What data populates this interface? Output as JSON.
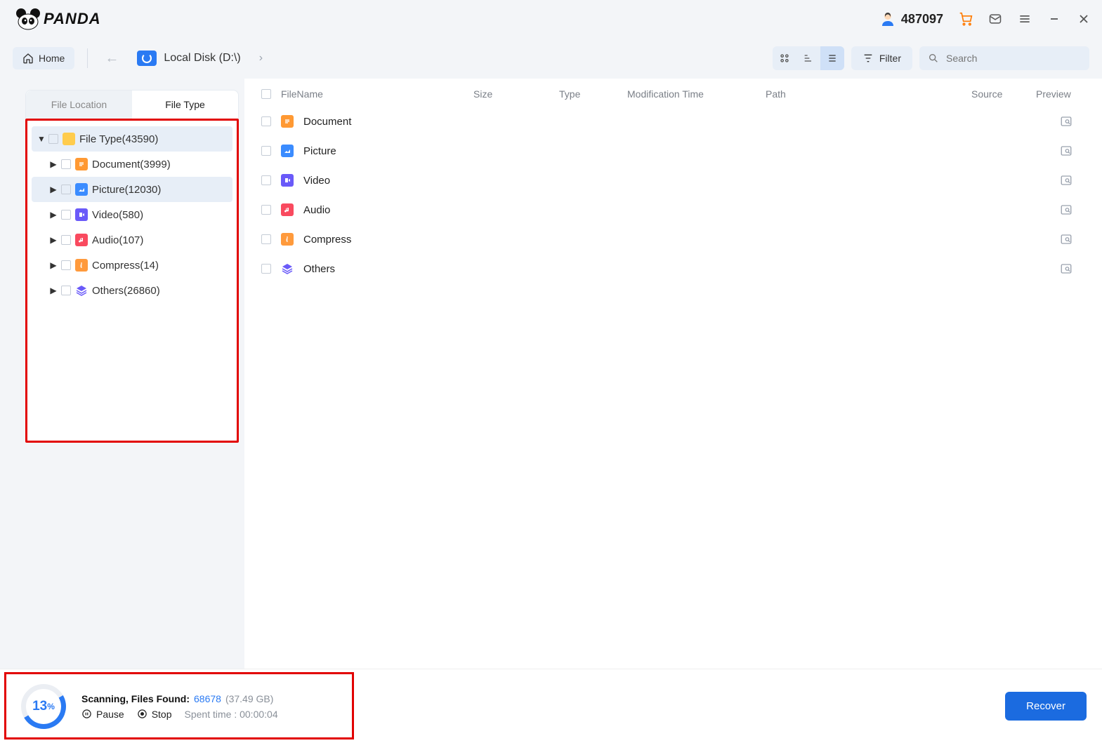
{
  "header": {
    "brand": "PANDA",
    "user_id": "487097"
  },
  "toolbar": {
    "home_label": "Home",
    "disk_label": "Local Disk (D:\\)",
    "filter_label": "Filter",
    "search_placeholder": "Search"
  },
  "sidebar": {
    "tabs": {
      "location": "File Location",
      "type": "File Type"
    },
    "root": {
      "label": "File Type",
      "count": 43590
    },
    "items": [
      {
        "label": "Document",
        "count": 3999,
        "icon": "doc"
      },
      {
        "label": "Picture",
        "count": 12030,
        "icon": "pic",
        "selected": true
      },
      {
        "label": "Video",
        "count": 580,
        "icon": "vid"
      },
      {
        "label": "Audio",
        "count": 107,
        "icon": "aud"
      },
      {
        "label": "Compress",
        "count": 14,
        "icon": "zip"
      },
      {
        "label": "Others",
        "count": 26860,
        "icon": "oth"
      }
    ]
  },
  "table": {
    "headers": {
      "name": "FileName",
      "size": "Size",
      "type": "Type",
      "mod": "Modification Time",
      "path": "Path",
      "src": "Source",
      "prev": "Preview"
    },
    "rows": [
      {
        "label": "Document",
        "icon": "doc"
      },
      {
        "label": "Picture",
        "icon": "pic"
      },
      {
        "label": "Video",
        "icon": "vid"
      },
      {
        "label": "Audio",
        "icon": "aud"
      },
      {
        "label": "Compress",
        "icon": "zip"
      },
      {
        "label": "Others",
        "icon": "oth"
      }
    ]
  },
  "status": {
    "percent": "13",
    "percent_sym": "%",
    "scan_label": "Scanning, Files Found:",
    "count": "68678",
    "size": "(37.49 GB)",
    "pause": "Pause",
    "stop": "Stop",
    "spent_label": "Spent time : ",
    "spent_time": "00:00:04",
    "recover": "Recover"
  }
}
